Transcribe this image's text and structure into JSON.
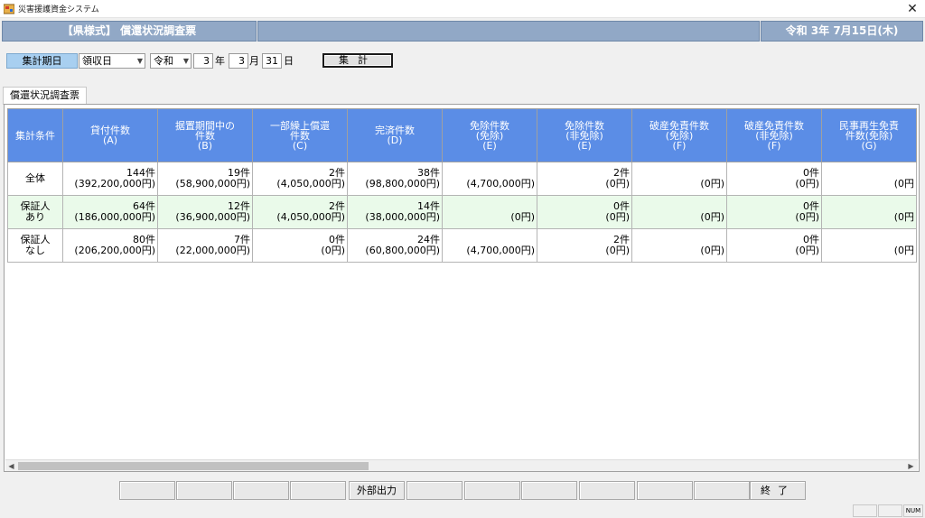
{
  "window": {
    "title": "災害援護資金システム",
    "close": "✕"
  },
  "header": {
    "form_title": "【県様式】 償還状況調査票",
    "middle": "",
    "date": "令和  3年  7月15日(木)"
  },
  "controls": {
    "period_label": "集計期日",
    "basis": "領収日",
    "era": "令和",
    "year": "3",
    "year_unit": "年",
    "month": "3",
    "month_unit": "月",
    "day": "31",
    "day_unit": "日",
    "calc_button": "集計"
  },
  "tab": {
    "label": "償還状況調査票"
  },
  "grid": {
    "columns": [
      [
        "集計条件"
      ],
      [
        "貸付件数",
        "(A)"
      ],
      [
        "据置期間中の",
        "件数",
        "(B)"
      ],
      [
        "一部繰上償還",
        "件数",
        "(C)"
      ],
      [
        "完済件数",
        "(D)"
      ],
      [
        "免除件数",
        "(免除)",
        "(E)"
      ],
      [
        "免除件数",
        "(非免除)",
        "(E)"
      ],
      [
        "破産免責件数",
        "(免除)",
        "(F)"
      ],
      [
        "破産免責件数",
        "(非免除)",
        "(F)"
      ],
      [
        "民事再生免責",
        "件数(免除)",
        "(G)"
      ]
    ],
    "rows": [
      {
        "condition": [
          "全体"
        ],
        "cells": [
          [
            "144件",
            "(392,200,000円)"
          ],
          [
            "19件",
            "(58,900,000円)"
          ],
          [
            "2件",
            "(4,050,000円)"
          ],
          [
            "38件",
            "(98,800,000円)"
          ],
          [
            "",
            "(4,700,000円)"
          ],
          [
            "2件",
            "(0円)"
          ],
          [
            "",
            "(0円)"
          ],
          [
            "0件",
            "(0円)"
          ],
          [
            "",
            "(0円"
          ]
        ]
      },
      {
        "condition": [
          "保証人",
          "あり"
        ],
        "cells": [
          [
            "64件",
            "(186,000,000円)"
          ],
          [
            "12件",
            "(36,900,000円)"
          ],
          [
            "2件",
            "(4,050,000円)"
          ],
          [
            "14件",
            "(38,000,000円)"
          ],
          [
            "",
            "(0円)"
          ],
          [
            "0件",
            "(0円)"
          ],
          [
            "",
            "(0円)"
          ],
          [
            "0件",
            "(0円)"
          ],
          [
            "",
            "(0円"
          ]
        ]
      },
      {
        "condition": [
          "保証人",
          "なし"
        ],
        "cells": [
          [
            "80件",
            "(206,200,000円)"
          ],
          [
            "7件",
            "(22,000,000円)"
          ],
          [
            "0件",
            "(0円)"
          ],
          [
            "24件",
            "(60,800,000円)"
          ],
          [
            "",
            "(4,700,000円)"
          ],
          [
            "2件",
            "(0円)"
          ],
          [
            "",
            "(0円)"
          ],
          [
            "0件",
            "(0円)"
          ],
          [
            "",
            "(0円"
          ]
        ]
      }
    ]
  },
  "scrollbar": {
    "left_arrow": "◀",
    "right_arrow": "▶"
  },
  "footer_buttons": [
    "",
    "",
    "",
    "",
    "外部出力",
    "",
    "",
    "",
    "",
    "",
    "",
    "終了"
  ],
  "status_bar": [
    "",
    "",
    "NUM"
  ],
  "colors": {
    "header_band": "#91a8c6",
    "grid_header": "#5b8de6",
    "alt_row": "#eafaea",
    "label": "#a8cff0"
  }
}
